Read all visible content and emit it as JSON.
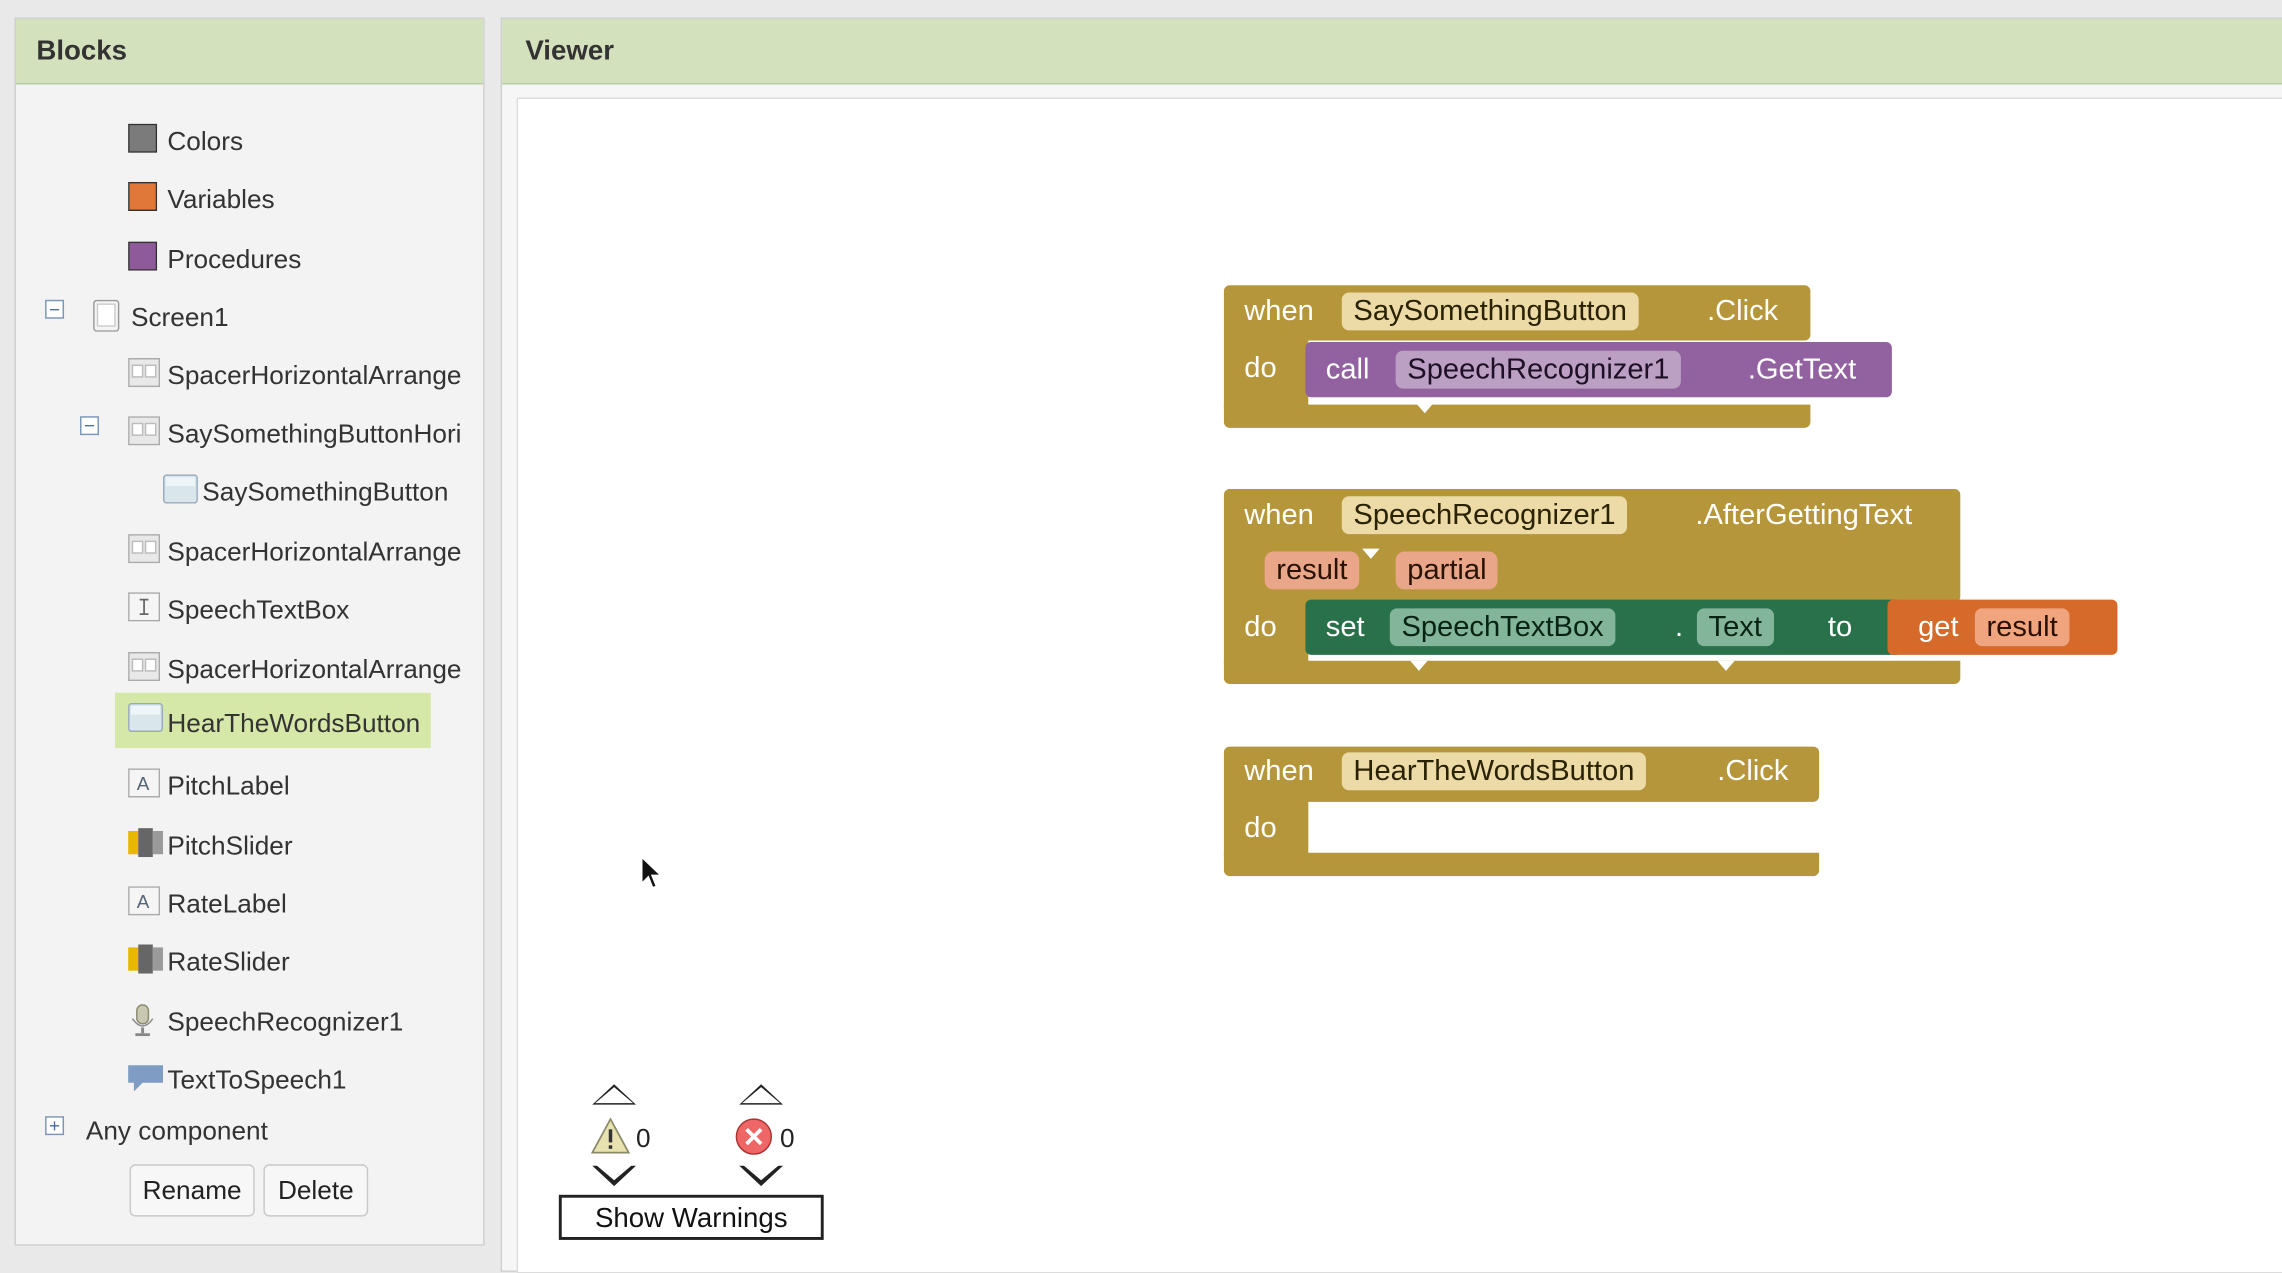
{
  "blocks_panel": {
    "title": "Blocks",
    "items": [
      {
        "label": "Colors",
        "icon": "colors-swatch-icon",
        "color": "#7b7b7b"
      },
      {
        "label": "Variables",
        "icon": "variables-swatch-icon",
        "color": "#e0783a"
      },
      {
        "label": "Procedures",
        "icon": "procedures-swatch-icon",
        "color": "#8e5a99"
      },
      {
        "label": "Screen1",
        "icon": "screen-icon"
      },
      {
        "label": "SpacerHorizontalArrange",
        "icon": "horizontal-arrangement-icon"
      },
      {
        "label": "SaySomethingButtonHori",
        "icon": "horizontal-arrangement-icon"
      },
      {
        "label": "SaySomethingButton",
        "icon": "button-icon"
      },
      {
        "label": "SpacerHorizontalArrange",
        "icon": "horizontal-arrangement-icon"
      },
      {
        "label": "SpeechTextBox",
        "icon": "textbox-icon"
      },
      {
        "label": "SpacerHorizontalArrange",
        "icon": "horizontal-arrangement-icon"
      },
      {
        "label": "HearTheWordsButton",
        "icon": "button-icon",
        "selected": true
      },
      {
        "label": "PitchLabel",
        "icon": "label-icon"
      },
      {
        "label": "PitchSlider",
        "icon": "slider-icon"
      },
      {
        "label": "RateLabel",
        "icon": "label-icon"
      },
      {
        "label": "RateSlider",
        "icon": "slider-icon"
      },
      {
        "label": "SpeechRecognizer1",
        "icon": "speech-recognizer-icon"
      },
      {
        "label": "TextToSpeech1",
        "icon": "text-to-speech-icon"
      }
    ],
    "any_component": "Any component",
    "rename_label": "Rename",
    "delete_label": "Delete"
  },
  "viewer": {
    "title": "Viewer",
    "block1": {
      "when": "when",
      "component": "SaySomethingButton",
      "event": ".Click",
      "do": "do",
      "call": "call",
      "call_component": "SpeechRecognizer1",
      "method": ".GetText"
    },
    "block2": {
      "when": "when",
      "component": "SpeechRecognizer1",
      "event": ".AfterGettingText",
      "param1": "result",
      "param2": "partial",
      "do": "do",
      "set": "set",
      "set_component": "SpeechTextBox",
      "dot": ".",
      "property": "Text",
      "to": "to",
      "get": "get",
      "get_var": "result"
    },
    "block3": {
      "when": "when",
      "component": "HearTheWordsButton",
      "event": ".Click",
      "do": "do"
    },
    "warnings_count": "0",
    "errors_count": "0",
    "show_warnings_label": "Show Warnings"
  },
  "colors": {
    "event_block": "#b5963a",
    "procedure_block": "#9262a0",
    "setter_block": "#29714a",
    "getter_block": "#d56a2b",
    "panel_header": "#d3e2bd",
    "selected_item": "#d6e8a8"
  }
}
